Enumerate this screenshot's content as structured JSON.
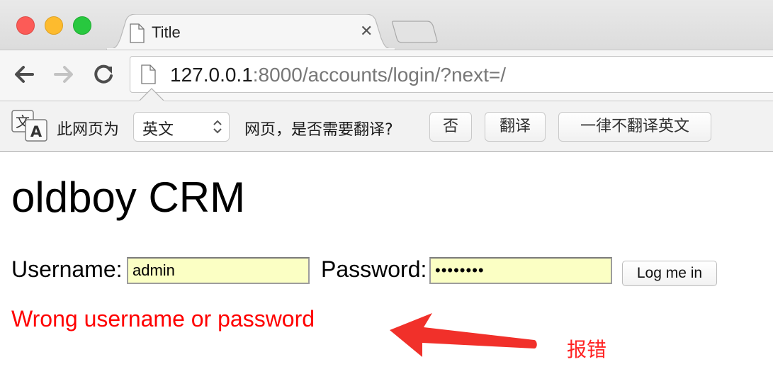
{
  "browser": {
    "tab_title": "Title",
    "tab_close_glyph": "✕",
    "url_host": "127.0.0.1",
    "url_rest": ":8000/accounts/login/?next=/",
    "icons": {
      "back": "back-arrow-icon",
      "forward": "forward-arrow-icon",
      "reload": "reload-icon",
      "page": "page-icon",
      "translate": "translate-icon"
    },
    "traffic_colors": {
      "close": "#fc5b57",
      "minimize": "#fdbb2e",
      "zoom": "#28c83f"
    }
  },
  "translate_bar": {
    "prefix": "此网页为",
    "language_value": "英文",
    "question": "网页，是否需要翻译?",
    "no_label": "否",
    "translate_label": "翻译",
    "never_label": "一律不翻译英文"
  },
  "page": {
    "heading": "oldboy CRM",
    "username_label": "Username:",
    "username_value": "admin",
    "password_label": "Password:",
    "password_mask": "••••••••",
    "login_button": "Log me in",
    "error_message": "Wrong username or password",
    "error_color": "#ff0000"
  },
  "annotation": {
    "label": "报错",
    "color": "#ff2222"
  }
}
